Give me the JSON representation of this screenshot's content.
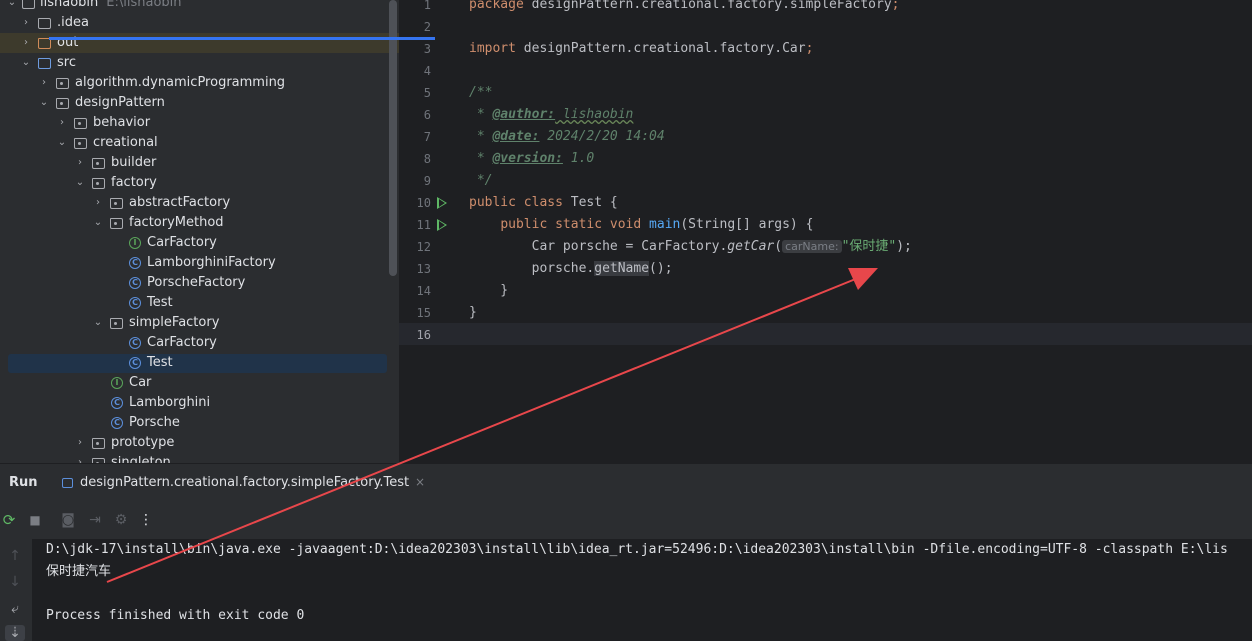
{
  "project": {
    "root_label": "lishaobin",
    "root_path": "E:\\lishaobin",
    "items": [
      {
        "label": ".idea"
      },
      {
        "label": "out"
      },
      {
        "label": "src"
      },
      {
        "label": "algorithm.dynamicProgramming"
      },
      {
        "label": "designPattern"
      },
      {
        "label": "behavior"
      },
      {
        "label": "creational"
      },
      {
        "label": "builder"
      },
      {
        "label": "factory"
      },
      {
        "label": "abstractFactory"
      },
      {
        "label": "factoryMethod"
      },
      {
        "label": "CarFactory"
      },
      {
        "label": "LamborghiniFactory"
      },
      {
        "label": "PorscheFactory"
      },
      {
        "label": "Test"
      },
      {
        "label": "simpleFactory"
      },
      {
        "label": "CarFactory"
      },
      {
        "label": "Test"
      },
      {
        "label": "Car"
      },
      {
        "label": "Lamborghini"
      },
      {
        "label": "Porsche"
      },
      {
        "label": "prototype"
      },
      {
        "label": "singleton"
      }
    ]
  },
  "editor": {
    "line_numbers": [
      "1",
      "2",
      "3",
      "4",
      "5",
      "6",
      "7",
      "8",
      "9",
      "10",
      "11",
      "12",
      "13",
      "14",
      "15",
      "16"
    ],
    "line1": {
      "kw": "package",
      "rest": " designPattern.creational.factory.simpleFactory",
      "semi": ";"
    },
    "line3": {
      "kw": "import",
      "rest": " designPattern.creational.factory.Car",
      "semi": ";"
    },
    "line5": "/**",
    "line6": {
      "star": " * ",
      "tag": "@author:",
      "val": " lishaobin"
    },
    "line7": {
      "star": " * ",
      "tag": "@date:",
      "val": " 2024/2/20 14:04"
    },
    "line8": {
      "star": " * ",
      "tag": "@version:",
      "val": " 1.0"
    },
    "line9": " */",
    "line10": {
      "kw1": "public",
      "kw2": " class",
      "rest": " Test {"
    },
    "line11": {
      "indent": "    ",
      "kw1": "public",
      "kw2": " static",
      "kw3": " void",
      "fn": " main",
      "rest": "(String[] args) {"
    },
    "line12": {
      "indent": "        ",
      "a": "Car porsche = CarFactory.",
      "method": "getCar",
      "b": "(",
      "hint": "carName:",
      "str": "\"保时捷\"",
      "c": ");"
    },
    "line13": {
      "indent": "        ",
      "a": "porsche.",
      "method": "getName",
      "c": "();"
    },
    "line14": "    }",
    "line15": "}"
  },
  "run": {
    "title": "Run",
    "tab_label": "designPattern.creational.factory.simpleFactory.Test",
    "close": "×"
  },
  "toolbar": {
    "rerun": "⟳",
    "stop": "■",
    "camera": "◙",
    "exit": "⇥",
    "settings": "⚙",
    "more": "⋮"
  },
  "console": {
    "cmd": "D:\\jdk-17\\install\\bin\\java.exe -javaagent:D:\\idea202303\\install\\lib\\idea_rt.jar=52496:D:\\idea202303\\install\\bin -Dfile.encoding=UTF-8 -classpath E:\\lis",
    "output": "保时捷汽车",
    "finished": "Process finished with exit code 0"
  },
  "colors": {
    "accent": "#3574f0",
    "annotation_arrow": "#e8474b",
    "run_marker": "#5fb865"
  }
}
